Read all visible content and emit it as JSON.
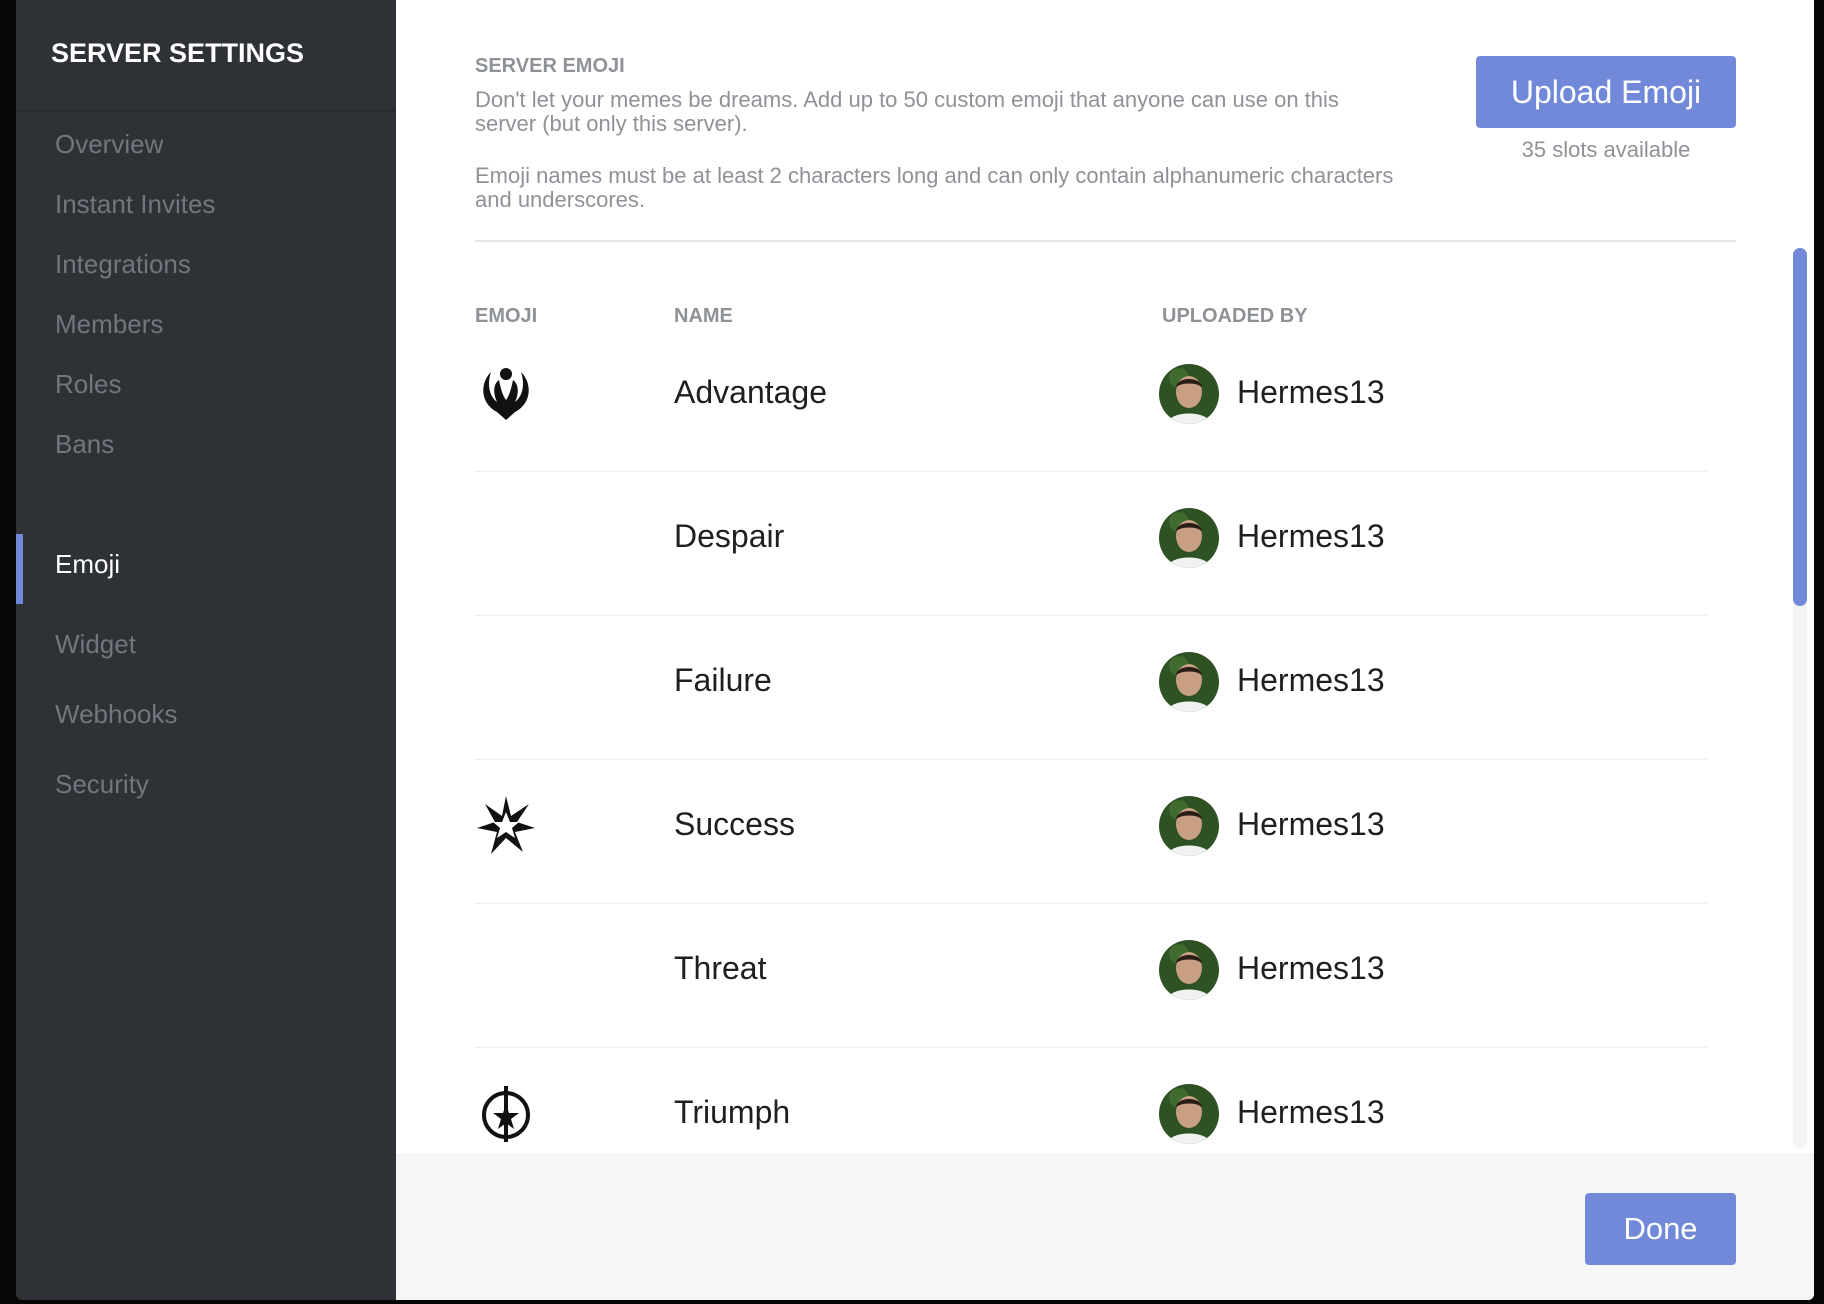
{
  "sidebar": {
    "title": "SERVER SETTINGS",
    "items": [
      {
        "label": "Overview",
        "selected": false
      },
      {
        "label": "Instant Invites",
        "selected": false
      },
      {
        "label": "Integrations",
        "selected": false
      },
      {
        "label": "Members",
        "selected": false
      },
      {
        "label": "Roles",
        "selected": false
      },
      {
        "label": "Bans",
        "selected": false
      },
      {
        "label": "Emoji",
        "selected": true
      },
      {
        "label": "Widget",
        "selected": false
      },
      {
        "label": "Webhooks",
        "selected": false
      },
      {
        "label": "Security",
        "selected": false
      }
    ]
  },
  "main": {
    "section_title": "SERVER EMOJI",
    "description_1": "Don't let your memes be dreams. Add up to 50 custom emoji that anyone can use on this server (but only this server).",
    "description_2": "Emoji names must be at least 2 characters long and can only contain alphanumeric characters and underscores.",
    "upload_button_label": "Upload Emoji",
    "slots_text": "35 slots available",
    "columns": {
      "emoji": "EMOJI",
      "name": "NAME",
      "uploaded_by": "UPLOADED BY"
    },
    "rows": [
      {
        "name": "Advantage",
        "uploader": "Hermes13",
        "icon": "advantage-icon"
      },
      {
        "name": "Despair",
        "uploader": "Hermes13",
        "icon": ""
      },
      {
        "name": "Failure",
        "uploader": "Hermes13",
        "icon": ""
      },
      {
        "name": "Success",
        "uploader": "Hermes13",
        "icon": "success-icon"
      },
      {
        "name": "Threat",
        "uploader": "Hermes13",
        "icon": ""
      },
      {
        "name": "Triumph",
        "uploader": "Hermes13",
        "icon": "triumph-icon"
      }
    ],
    "done_button_label": "Done"
  },
  "colors": {
    "accent": "#7289da",
    "sidebar_bg": "#2e3136",
    "muted_text": "#8e9297"
  }
}
